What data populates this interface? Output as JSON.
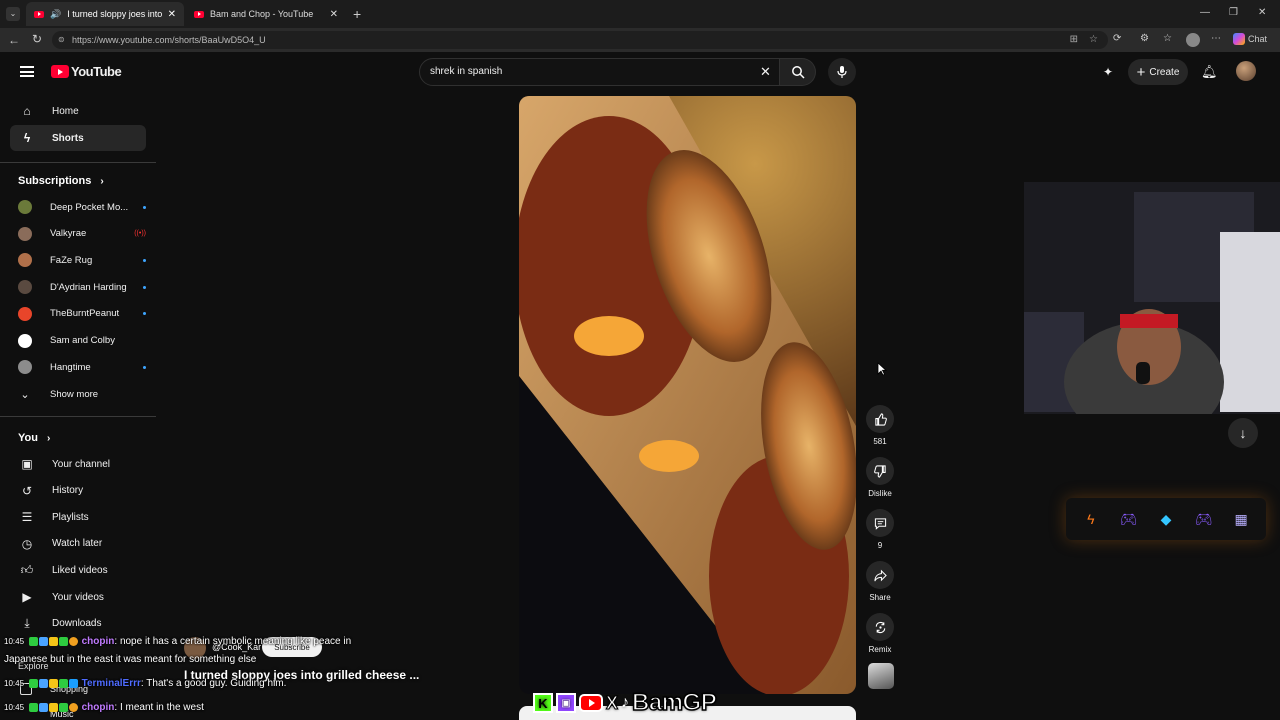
{
  "browser": {
    "tabs": [
      {
        "title": "I turned sloppy joes into grille"
      },
      {
        "title": "Bam and Chop - YouTube"
      }
    ],
    "url": "https://www.youtube.com/shorts/BaaUwD5O4_U",
    "chat_label": "Chat"
  },
  "header": {
    "logo": "YouTube",
    "search_value": "shrek in spanish",
    "create_label": "Create"
  },
  "sidebar": {
    "top": [
      {
        "label": "Home",
        "icon": "home-icon"
      },
      {
        "label": "Shorts",
        "icon": "shorts-icon"
      }
    ],
    "subscriptions_title": "Subscriptions",
    "subscriptions": [
      {
        "label": "Deep Pocket Mo...",
        "status": "new",
        "color": "#6b7a3a"
      },
      {
        "label": "Valkyrae",
        "status": "live",
        "color": "#8a6c5a"
      },
      {
        "label": "FaZe Rug",
        "status": "new",
        "color": "#b0704a"
      },
      {
        "label": "D'Aydrian Harding",
        "status": "new",
        "color": "#5a4a40"
      },
      {
        "label": "TheBurntPeanut",
        "status": "new",
        "color": "#e8452a"
      },
      {
        "label": "Sam and Colby",
        "status": "none",
        "color": "#ffffff"
      },
      {
        "label": "Hangtime",
        "status": "new",
        "color": "#8c8c8c"
      }
    ],
    "show_more": "Show more",
    "you_title": "You",
    "you_items": [
      {
        "label": "Your channel",
        "icon": "user-square-icon"
      },
      {
        "label": "History",
        "icon": "history-icon"
      },
      {
        "label": "Playlists",
        "icon": "playlists-icon"
      },
      {
        "label": "Watch later",
        "icon": "clock-icon"
      },
      {
        "label": "Liked videos",
        "icon": "thumbs-up-icon"
      },
      {
        "label": "Your videos",
        "icon": "play-square-icon"
      },
      {
        "label": "Downloads",
        "icon": "download-icon"
      }
    ],
    "explore_title": "Explore",
    "explore_items": [
      {
        "label": "Shopping"
      },
      {
        "label": "Music"
      }
    ]
  },
  "short": {
    "title": "I turned sloppy joes into grilled cheese ...",
    "channel": "@Cook_Kar",
    "subscribe_label": "Subscribe"
  },
  "actions": {
    "like_count": "581",
    "dislike_label": "Dislike",
    "comment_count": "9",
    "share_label": "Share",
    "remix_label": "Remix"
  },
  "chat": {
    "messages": [
      {
        "time": "10:45",
        "user": "chopin",
        "user_color": "#c07bff",
        "text": "nope it has a certain symbolic meaning like peace in",
        "text2": "Japanese but in the east it was meant for something else"
      },
      {
        "time": "10:45",
        "user": "TerminalErrr",
        "user_color": "#4f6cff",
        "text": "That's a good guy. Guiding him."
      },
      {
        "time": "10:45",
        "user": "chopin",
        "user_color": "#c07bff",
        "text": "I meant in the west"
      }
    ]
  },
  "overlay": {
    "brand": "BamGP",
    "socials": [
      "K",
      "twitch",
      "youtube",
      "X",
      "tiktok"
    ]
  }
}
